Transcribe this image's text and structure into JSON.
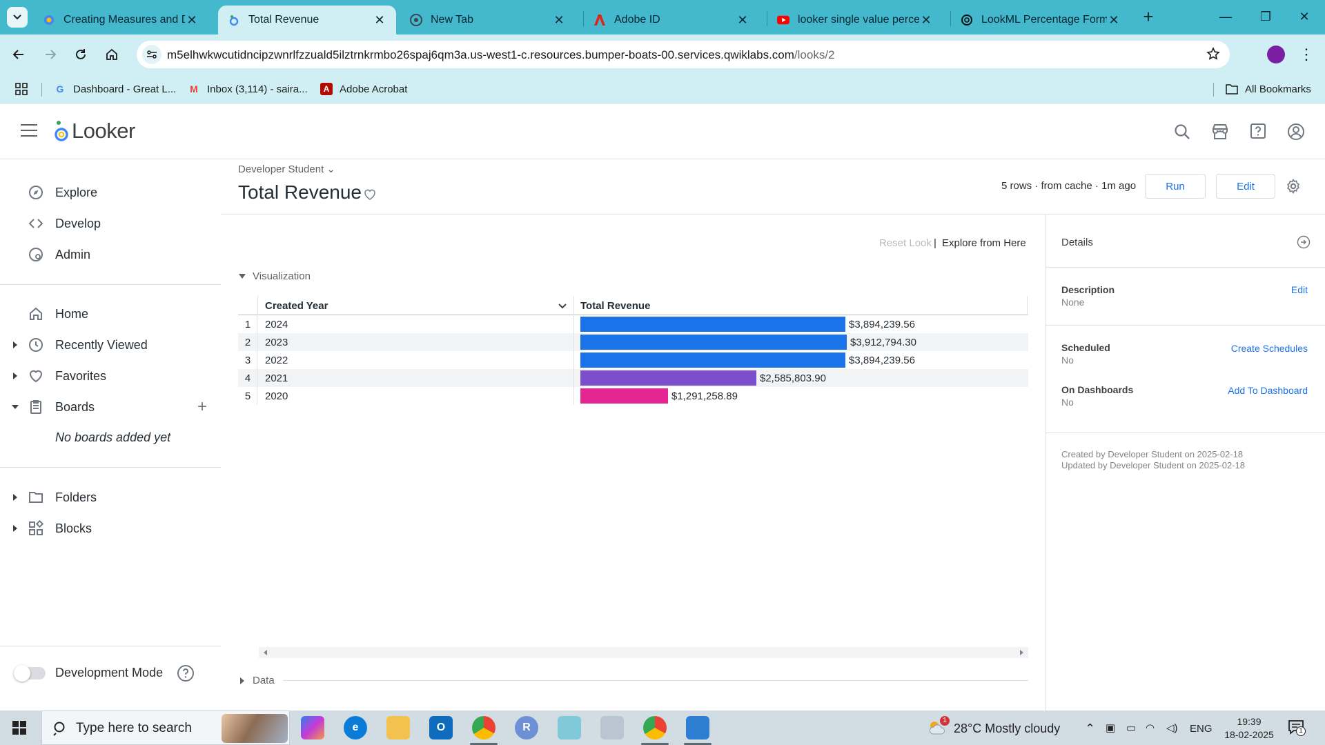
{
  "browser": {
    "tabs": [
      {
        "title": "Creating Measures and Di",
        "icon": "looker-favicon"
      },
      {
        "title": "Total Revenue",
        "icon": "looker-favicon"
      },
      {
        "title": "New Tab",
        "icon": "chrome-icon"
      },
      {
        "title": "Adobe ID",
        "icon": "adobe-icon"
      },
      {
        "title": "looker single value percent",
        "icon": "youtube-icon"
      },
      {
        "title": "LookML Percentage Forma",
        "icon": "openai-icon"
      }
    ],
    "url_host": "m5elhwkwcutidncipzwnrlfzzuald5ilztrnkrmbo26spaj6qm3a.us-west1-c.resources.bumper-boats-00.services.qwiklabs.com",
    "url_path": "/looks/2",
    "bookmarks": [
      {
        "label": "Dashboard - Great L...",
        "icon": "G"
      },
      {
        "label": "Inbox (3,114) - saira...",
        "icon": "M"
      },
      {
        "label": "Adobe Acrobat",
        "icon": "A"
      }
    ],
    "all_bookmarks": "All Bookmarks",
    "tab_bar_color": "#44b8cd",
    "toolbar_color": "#cfeff4"
  },
  "looker": {
    "logo_text": "Looker",
    "nav": {
      "explore": "Explore",
      "develop": "Develop",
      "admin": "Admin",
      "home": "Home",
      "recently_viewed": "Recently Viewed",
      "favorites": "Favorites",
      "boards": "Boards",
      "boards_empty": "No boards added yet",
      "folders": "Folders",
      "blocks": "Blocks"
    },
    "dev_mode_label": "Development Mode",
    "dev_mode_on": false
  },
  "look": {
    "breadcrumb": "Developer Student",
    "title": "Total Revenue",
    "meta": "5 rows · from cache · 1m ago",
    "run_label": "Run",
    "edit_label": "Edit",
    "reset_look": "Reset Look",
    "explore_from_here": "Explore from Here",
    "visualization_label": "Visualization",
    "data_label": "Data"
  },
  "chart_data": {
    "type": "table",
    "columns": [
      "Created Year",
      "Total Revenue"
    ],
    "rows": [
      {
        "n": "1",
        "year": "2024",
        "revenue": 3894239.56,
        "label": "$3,894,239.56",
        "color": "#1a73e8"
      },
      {
        "n": "2",
        "year": "2023",
        "revenue": 3912794.3,
        "label": "$3,912,794.30",
        "color": "#1a73e8"
      },
      {
        "n": "3",
        "year": "2022",
        "revenue": 3894239.56,
        "label": "$3,894,239.56",
        "color": "#1a73e8"
      },
      {
        "n": "4",
        "year": "2021",
        "revenue": 2585803.9,
        "label": "$2,585,803.90",
        "color": "#7c4dcc"
      },
      {
        "n": "5",
        "year": "2020",
        "revenue": 1291258.89,
        "label": "$1,291,258.89",
        "color": "#e52592"
      }
    ],
    "bar_max": 3912794.3
  },
  "details": {
    "title": "Details",
    "description_label": "Description",
    "description_value": "None",
    "description_edit": "Edit",
    "scheduled_label": "Scheduled",
    "scheduled_value": "No",
    "create_schedules": "Create Schedules",
    "dashboards_label": "On Dashboards",
    "dashboards_value": "No",
    "add_to_dashboard": "Add To Dashboard",
    "created_by": "Created by Developer Student on 2025-02-18",
    "updated_by": "Updated by Developer Student on 2025-02-18"
  },
  "taskbar": {
    "search_placeholder": "Type here to search",
    "weather": "28°C  Mostly cloudy",
    "weather_badge": "1",
    "language": "ENG",
    "time": "19:39",
    "date": "18-02-2025",
    "notifications": "1"
  }
}
